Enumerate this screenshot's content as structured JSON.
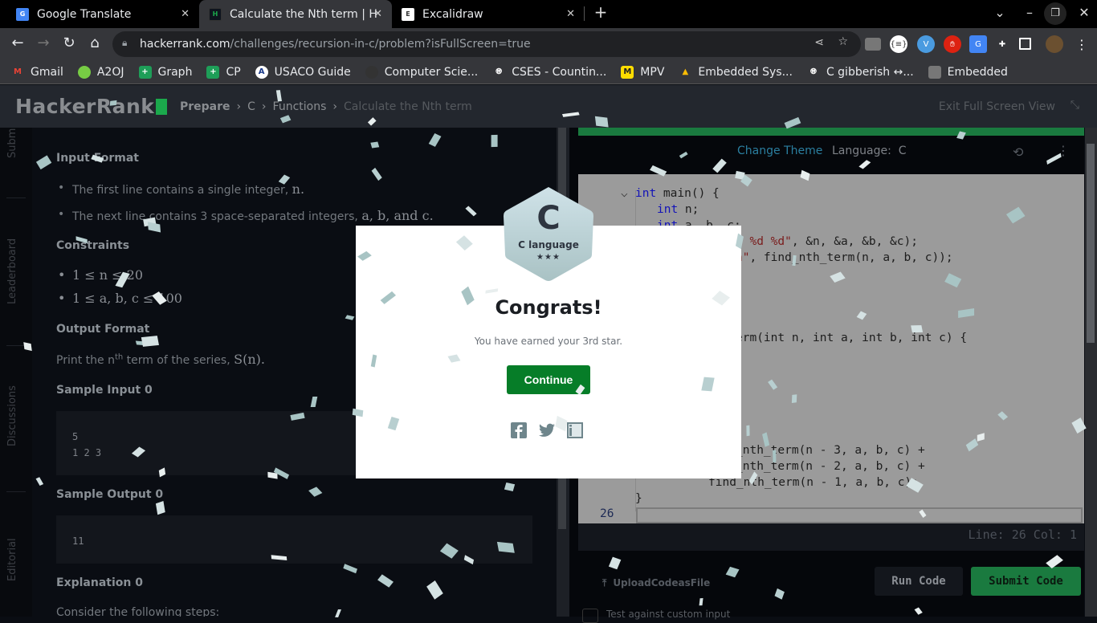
{
  "browser": {
    "tabs": [
      {
        "title": "Google Translate",
        "favicon": "G",
        "active": false
      },
      {
        "title": "Calculate the Nth term | H",
        "favicon": "H",
        "active": true
      },
      {
        "title": "Excalidraw",
        "favicon": "E",
        "active": false
      }
    ],
    "url_host": "hackerrank.com",
    "url_path": "/challenges/recursion-in-c/problem?isFullScreen=true",
    "bookmarks": [
      "Gmail",
      "A2OJ",
      "Graph",
      "CP",
      "USACO Guide",
      "Computer Scie...",
      "CSES - Countin...",
      "MPV",
      "Embedded Sys...",
      "C gibberish ↔...",
      "Embedded"
    ]
  },
  "header": {
    "logo": "HackerRank",
    "breadcrumb": [
      "Prepare",
      "C",
      "Functions",
      "Calculate the Nth term"
    ],
    "exit_full_screen": "Exit Full Screen View"
  },
  "side_tabs": [
    "Subm",
    "Leaderboard",
    "Discussions",
    "Editorial"
  ],
  "problem": {
    "input_format_title": "Input Format",
    "input_lines": [
      "The first line contains a single integer, ",
      "The next line contains 3 space-separated integers, "
    ],
    "input_math": [
      "n.",
      "a, b, and c."
    ],
    "constraints_title": "Constraints",
    "constraints": [
      "1 ≤ n ≤ 20",
      "1 ≤ a, b, c ≤ 100"
    ],
    "output_format_title": "Output Format",
    "output_text_pre": "Print the n",
    "output_sup": "th",
    "output_text_post": " term of the series, ",
    "output_math": "S(n).",
    "sample_input_title": "Sample Input 0",
    "sample_input": "5\n1 2 3",
    "sample_output_title": "Sample Output 0",
    "sample_output": "11",
    "explanation_title": "Explanation 0",
    "explanation_text": "Consider the following steps:"
  },
  "editor": {
    "change_theme": "Change Theme",
    "language_label": "Language:",
    "language": "C",
    "code_lines": [
      {
        "kw": "int",
        "rest": " main() {"
      },
      {
        "kw": "int",
        "rest": " n;"
      },
      {
        "kw": "int",
        "rest": " a, b, c;"
      },
      {
        "st": "d %d %d\"",
        "rest": ", &n, &a, &b, &c);"
      },
      {
        "st": "n\"",
        "rest": ", find_nth_term(n, a, b, c));"
      },
      {
        "text": "erm(int n, int a, int b, int c) {"
      },
      {
        "text": "_nth_term(n - 3, a, b, c) +"
      },
      {
        "text": "_nth_term(n - 2, a, b, c) +"
      },
      {
        "text": "find_nth_term(n - 1, a, b, c);"
      },
      {
        "text": "}"
      }
    ],
    "current_line_number": "26",
    "line_col": "Line: 26 Col: 1",
    "upload": "UploadCodeasFile",
    "run_code": "Run Code",
    "submit_code": "Submit Code",
    "custom_input": "Test against custom input"
  },
  "modal": {
    "badge_letter": "C",
    "badge_name": "C language",
    "badge_stars": "★★★",
    "title": "Congrats!",
    "message": "You have earned your 3rd star.",
    "continue": "Continue"
  },
  "colors": {
    "accent_green": "#1ba94c",
    "continue_green": "#067d28"
  }
}
